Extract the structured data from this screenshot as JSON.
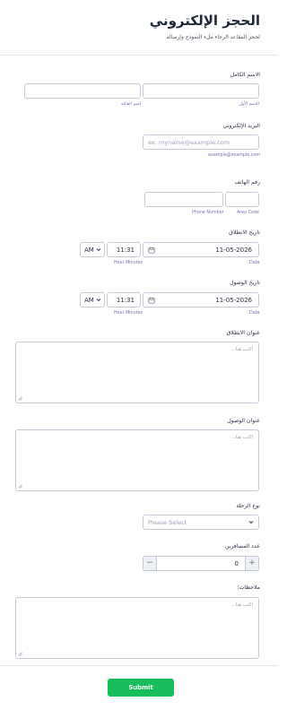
{
  "header": {
    "title": "الحجز الإلكتروني",
    "subtitle": "لحجز المقاعد الرجاء ملء النموذج وإرساله"
  },
  "full_name": {
    "label": "الاسم الكامل",
    "first_sub": "الاسم الأول",
    "last_sub": "اسم العائلة"
  },
  "email": {
    "label": "البريد الإلكتروني",
    "placeholder": "ex: myname@example.com",
    "sub": "example@example.com"
  },
  "phone": {
    "label": "رقم الهاتف",
    "number_sub": "Phone Number",
    "area_sub": "Area Code"
  },
  "departure_date": {
    "label": "تاريخ الانطلاق",
    "date": "11-05-2026",
    "time": "11:31",
    "ampm": "AM",
    "date_sub": "Date",
    "time_sub": "Hour Minutes"
  },
  "arrival_date": {
    "label": "تاريخ الوصول",
    "date": "11-05-2026",
    "time": "11:31",
    "ampm": "AM",
    "date_sub": "Date",
    "time_sub": "Hour Minutes"
  },
  "departure_address": {
    "label": "عنوان الانطلاق",
    "placeholder": "اكتب هنا..."
  },
  "arrival_address": {
    "label": "عنوان الوصول",
    "placeholder": "اكتب هنا..."
  },
  "trip_type": {
    "label": "نوع الرحلة",
    "placeholder": "Please Select"
  },
  "passengers": {
    "label": "عدد المسافرين",
    "value": "0",
    "minus": "−",
    "plus": "+"
  },
  "notes": {
    "label": "ملاحظات؛",
    "placeholder": "اكتب هنا..."
  },
  "footer": {
    "submit_label": "Submit"
  },
  "colors": {
    "accent": "#18bd5b",
    "border": "#c3cad8",
    "sublabel": "#6f76a7"
  }
}
